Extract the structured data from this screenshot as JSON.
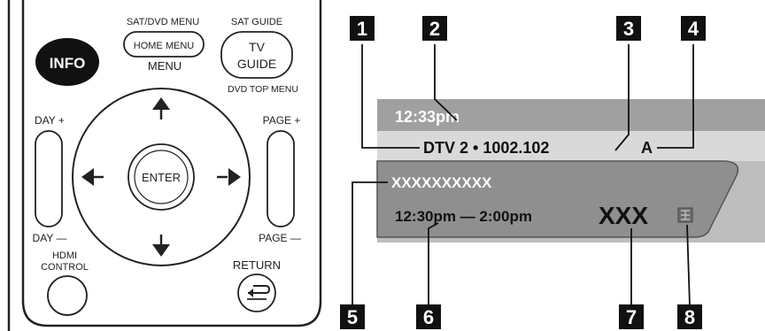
{
  "remote": {
    "info_label": "INFO",
    "sat_dvd_menu_label": "SAT/DVD MENU",
    "home_menu_label": "HOME MENU",
    "menu_label": "MENU",
    "sat_guide_label": "SAT GUIDE",
    "tv_guide_line1": "TV",
    "tv_guide_line2": "GUIDE",
    "dvd_top_menu_label": "DVD TOP MENU",
    "enter_label": "ENTER",
    "day_plus_label": "DAY +",
    "day_minus_label": "DAY —",
    "page_plus_label": "PAGE +",
    "page_minus_label": "PAGE —",
    "hdmi_label_line1": "HDMI",
    "hdmi_label_line2": "CONTROL",
    "return_label": "RETURN"
  },
  "osd": {
    "time": "12:33pm",
    "channel_info": "DTV 2 • 1002.102",
    "audio_indicator": "A",
    "program_title": "XXXXXXXXXX",
    "program_time": "12:30pm — 2:00pm",
    "rating": "XXX",
    "colors": {
      "top_band": "#a0a0a0",
      "channel_band": "#d9d9d9",
      "info_band": "#bdbdbd",
      "info_card": "#8f8f8f",
      "time_text": "#ffffff",
      "dark_text": "#111111"
    }
  },
  "callouts": [
    "1",
    "2",
    "3",
    "4",
    "5",
    "6",
    "7",
    "8"
  ]
}
